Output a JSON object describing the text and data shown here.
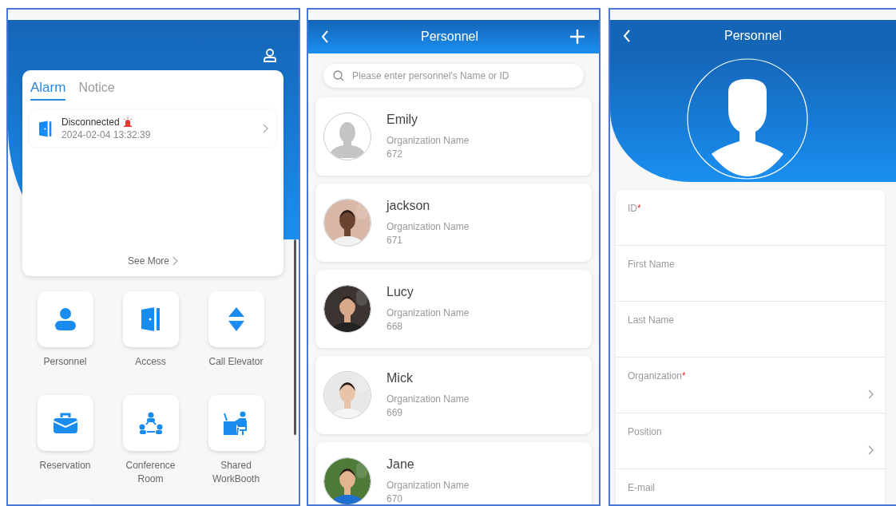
{
  "home": {
    "tabs": [
      {
        "label": "Alarm",
        "selected": true
      },
      {
        "label": "Notice",
        "selected": false
      }
    ],
    "alarms": [
      {
        "title": "Disconnected",
        "time": "2024-02-04 13:32:39",
        "alert": true
      }
    ],
    "see_more": "See More",
    "apps": [
      {
        "label": "Personnel",
        "kind": "person"
      },
      {
        "label": "Access",
        "kind": "door"
      },
      {
        "label": "Call Elevator",
        "kind": "elevator"
      },
      {
        "label": "Reservation",
        "kind": "briefcase"
      },
      {
        "label": "Conference Room",
        "kind": "meeting"
      },
      {
        "label": "Shared WorkBooth",
        "kind": "desk"
      },
      {
        "kind": "blank"
      }
    ]
  },
  "personnel_list": {
    "title": "Personnel",
    "search": {
      "placeholder": "Please enter personnel's Name or ID"
    },
    "people": [
      {
        "name": "Emily",
        "organization": "Organization Name",
        "id": "672",
        "kind": "placeholder"
      },
      {
        "name": "jackson",
        "organization": "Organization Name",
        "id": "671",
        "kind": "picture"
      },
      {
        "name": "Lucy",
        "organization": "Organization Name",
        "id": "668",
        "kind": "picture"
      },
      {
        "name": "Mick",
        "organization": "Organization Name",
        "id": "669",
        "kind": "picture"
      },
      {
        "name": "Jane",
        "organization": "Organization Name",
        "id": "670",
        "kind": "picture"
      }
    ]
  },
  "personnel_form": {
    "title": "Personnel",
    "fields": [
      {
        "label": "ID",
        "required_mark": "*",
        "kind": "text"
      },
      {
        "label": "First Name",
        "kind": "text"
      },
      {
        "label": "Last Name",
        "kind": "text"
      },
      {
        "label": "Organization",
        "required_mark": "*",
        "kind": "select"
      },
      {
        "label": "Position",
        "kind": "select"
      },
      {
        "label": "E-mail",
        "kind": "text"
      }
    ]
  }
}
